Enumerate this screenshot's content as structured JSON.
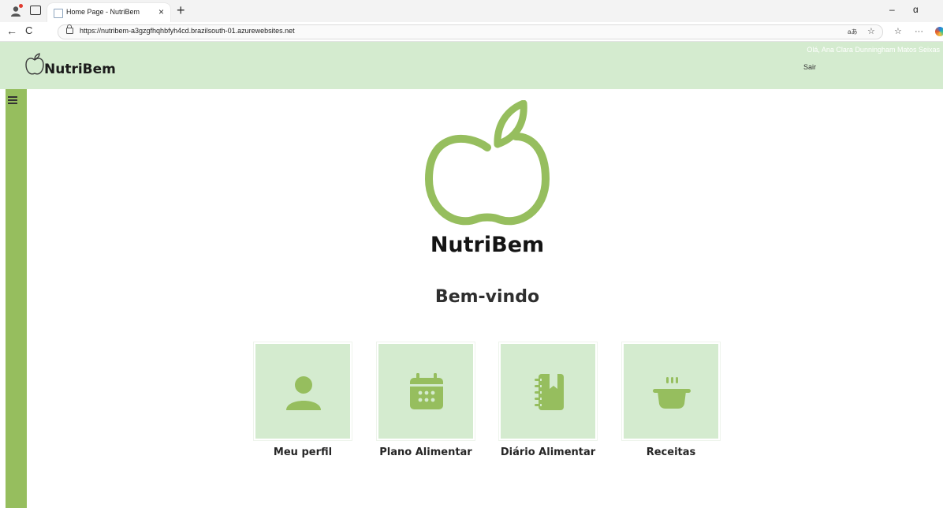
{
  "browser": {
    "tab_title": "Home Page - NutriBem",
    "tab_close": "×",
    "new_tab": "+",
    "url": "https://nutribem-a3gzgfhqhbfyh4cd.brazilsouth-01.azurewebsites.net",
    "back": "←",
    "refresh": "C",
    "read_aloud": "aあ",
    "favorite": "☆",
    "collections": "☆",
    "more": "···",
    "minimize": "–",
    "restore": "ɑ"
  },
  "header": {
    "brand": "NutriBem",
    "greeting": "Olá, Ana Clara Dunningham Matos Seixas",
    "logout": "Sair"
  },
  "main": {
    "brand": "NutriBem",
    "welcome": "Bem-vindo",
    "cards": [
      {
        "label": "Meu perfil",
        "icon": "user-icon"
      },
      {
        "label": "Plano Alimentar",
        "icon": "calendar-icon"
      },
      {
        "label": "Diário Alimentar",
        "icon": "journal-icon"
      },
      {
        "label": "Receitas",
        "icon": "cooking-pot-icon"
      }
    ]
  },
  "colors": {
    "header_bg": "#d4ebcf",
    "sidebar": "#96be5e",
    "accent": "#96be5e",
    "card_bg": "#d4ebcf"
  }
}
